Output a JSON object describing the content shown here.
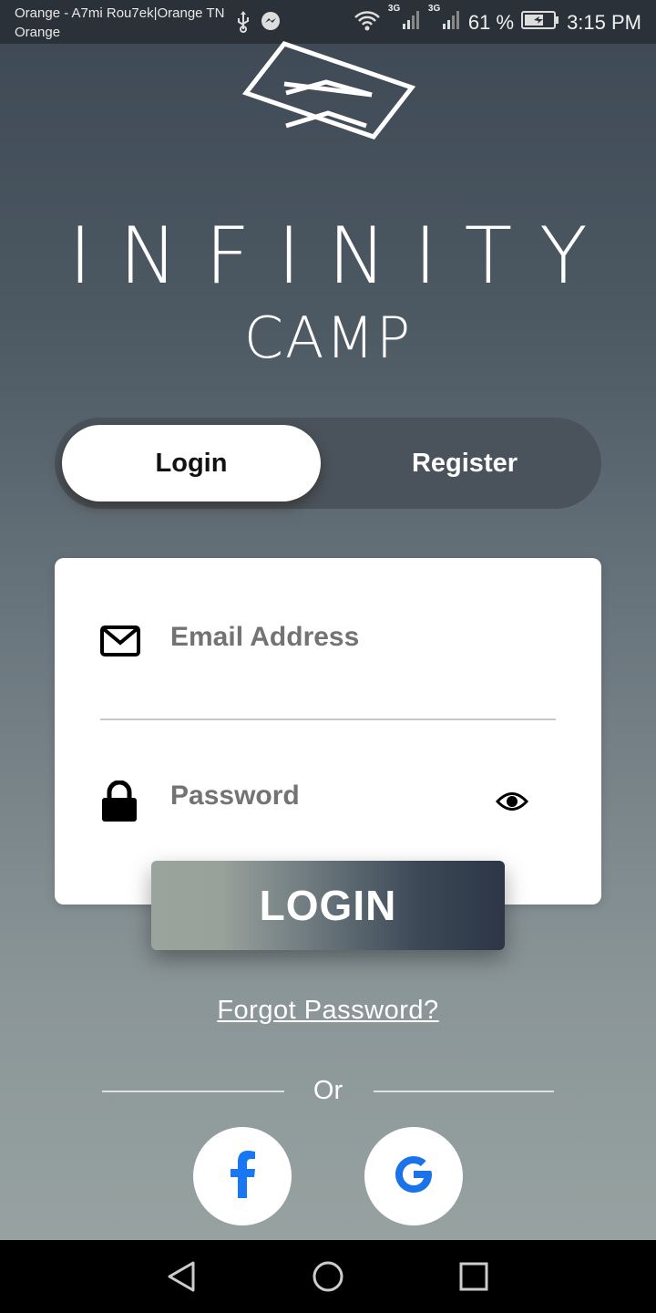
{
  "status_bar": {
    "carrier_line1": "Orange - A7mi Rou7ek|Orange TN",
    "carrier_line2": "Orange",
    "battery": "61 %",
    "time": "3:15 PM",
    "net1": "3G",
    "net2": "3G"
  },
  "brand": {
    "title": "INFINITY",
    "subtitle": "CAMP"
  },
  "tabs": {
    "login": "Login",
    "register": "Register"
  },
  "form": {
    "email_placeholder": "Email Address",
    "password_placeholder": "Password"
  },
  "actions": {
    "login_button": "LOGIN",
    "forgot_password": "Forgot Password?",
    "or": "Or"
  },
  "colors": {
    "facebook": "#1877f2",
    "google": "#1a73e8"
  }
}
